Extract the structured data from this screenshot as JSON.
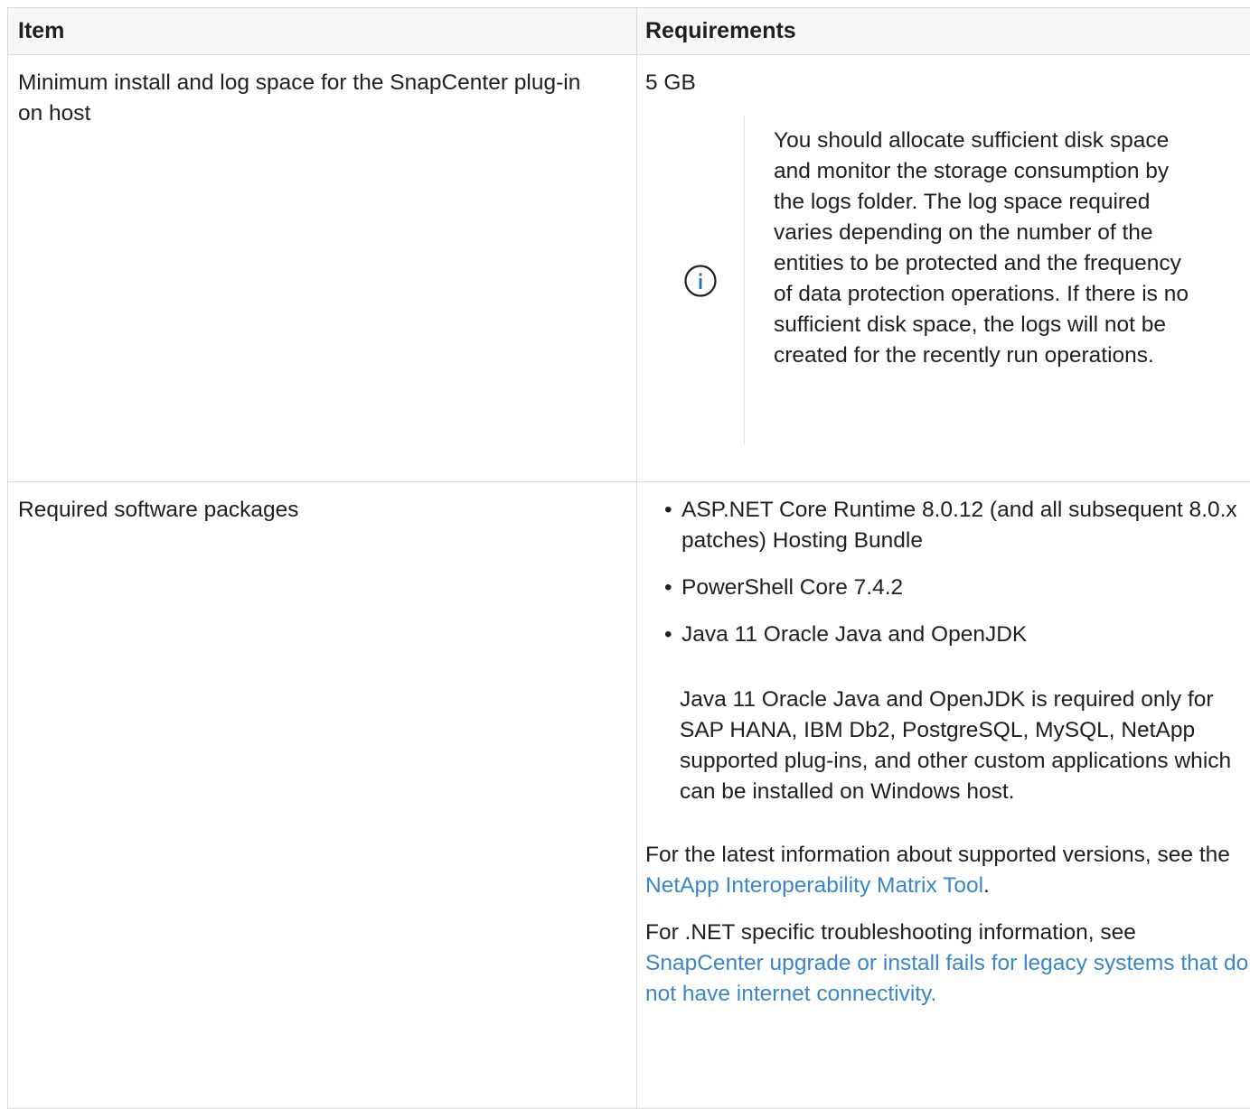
{
  "table": {
    "headers": {
      "item": "Item",
      "requirements": "Requirements"
    },
    "rows": [
      {
        "item": "Minimum install and log space for the SnapCenter plug-in on host",
        "value": "5 GB",
        "note": {
          "icon": "info-icon",
          "text": "You should allocate sufficient disk space and monitor the storage consumption by the logs folder. The log space required varies depending on the number of the entities to be protected and the frequency of data protection operations. If there is no sufficient disk space, the logs will not be created for the recently run operations."
        }
      },
      {
        "item": "Required software packages",
        "packages": [
          "ASP.NET Core Runtime 8.0.12 (and all subsequent 8.0.x patches) Hosting Bundle",
          "PowerShell Core 7.4.2",
          "Java 11 Oracle Java and OpenJDK"
        ],
        "java_note": "Java 11 Oracle Java and OpenJDK is required only for SAP HANA, IBM Db2, PostgreSQL, MySQL, NetApp supported plug-ins, and other custom applications which can be installed on Windows host.",
        "versions_para": {
          "prefix": "For the latest information about supported versions, see the ",
          "link": "NetApp Interoperability Matrix Tool",
          "suffix": "."
        },
        "dotnet_para": {
          "prefix": "For .NET specific troubleshooting information, see ",
          "link": "SnapCenter upgrade or install fails for legacy systems that do not have internet connectivity."
        }
      }
    ]
  },
  "colors": {
    "link": "#3b86c6",
    "info_icon": "#1f6fb5",
    "border": "#dadada",
    "header_bg": "#f7f7f7"
  },
  "bullet_glyph": "•"
}
